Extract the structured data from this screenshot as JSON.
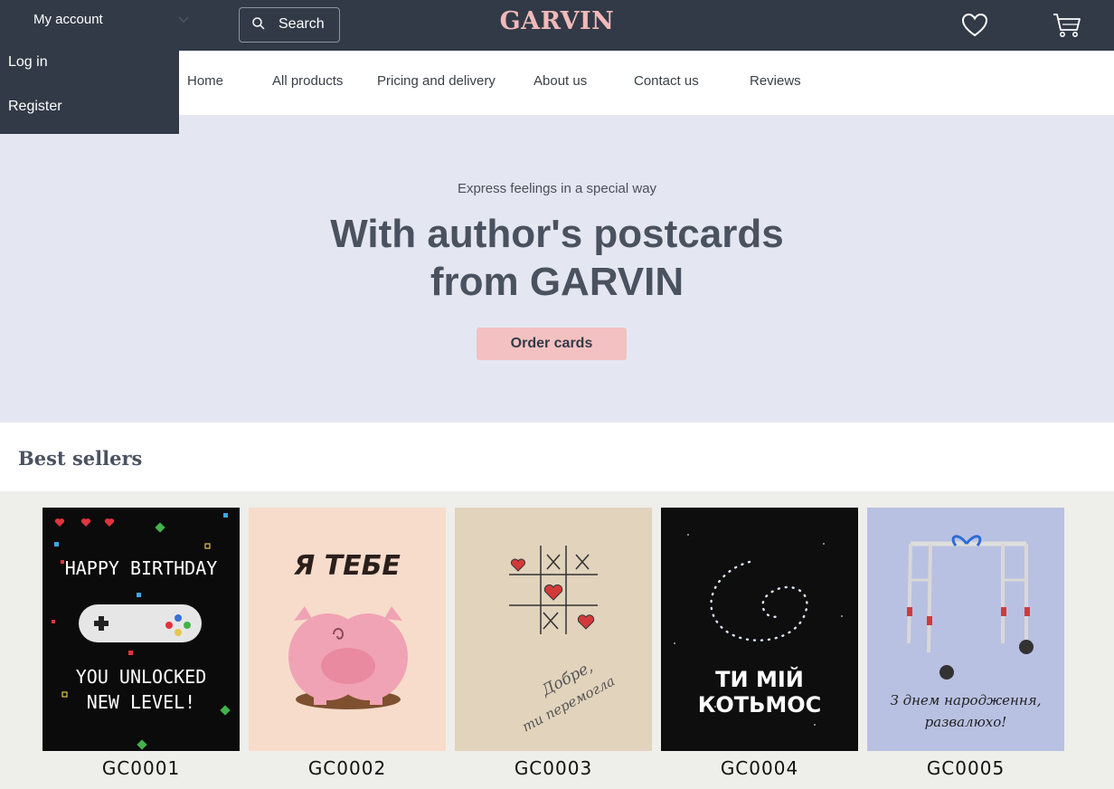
{
  "header": {
    "account_label": "My account",
    "search_label": "Search",
    "logo": "GARVIN",
    "icons": [
      "search-icon",
      "heart-icon",
      "cart-icon",
      "chevron-down-icon"
    ]
  },
  "account_menu": {
    "login": "Log in",
    "register": "Register"
  },
  "nav": {
    "home": "Home",
    "all_products": "All products",
    "pricing": "Pricing and delivery",
    "about": "About us",
    "contact": "Contact us",
    "reviews": "Reviews"
  },
  "hero": {
    "tagline": "Express feelings in a special way",
    "headline": "With author's postcards from GARVIN",
    "cta": "Order cards"
  },
  "best_sellers": {
    "title": "Best sellers",
    "products": [
      {
        "code": "GC0001",
        "card_text": [
          "HAPPY BIRTHDAY",
          "YOU UNLOCKED",
          "NEW LEVEL!"
        ]
      },
      {
        "code": "GC0002",
        "card_text": [
          "Я ТЕБЕ"
        ]
      },
      {
        "code": "GC0003",
        "card_text": [
          "Добре,",
          "ти перемогла"
        ]
      },
      {
        "code": "GC0004",
        "card_text": [
          "ТИ МІЙ",
          "КОТЬМОС"
        ]
      },
      {
        "code": "GC0005",
        "card_text": [
          "З днем народження,",
          "развалюхо!"
        ]
      }
    ]
  },
  "colors": {
    "topbar": "#323a47",
    "logo": "#f1b9ba",
    "hero_bg": "#e4e7f1",
    "cta_bg": "#f4c1c2",
    "products_bg": "#eeeeea"
  }
}
